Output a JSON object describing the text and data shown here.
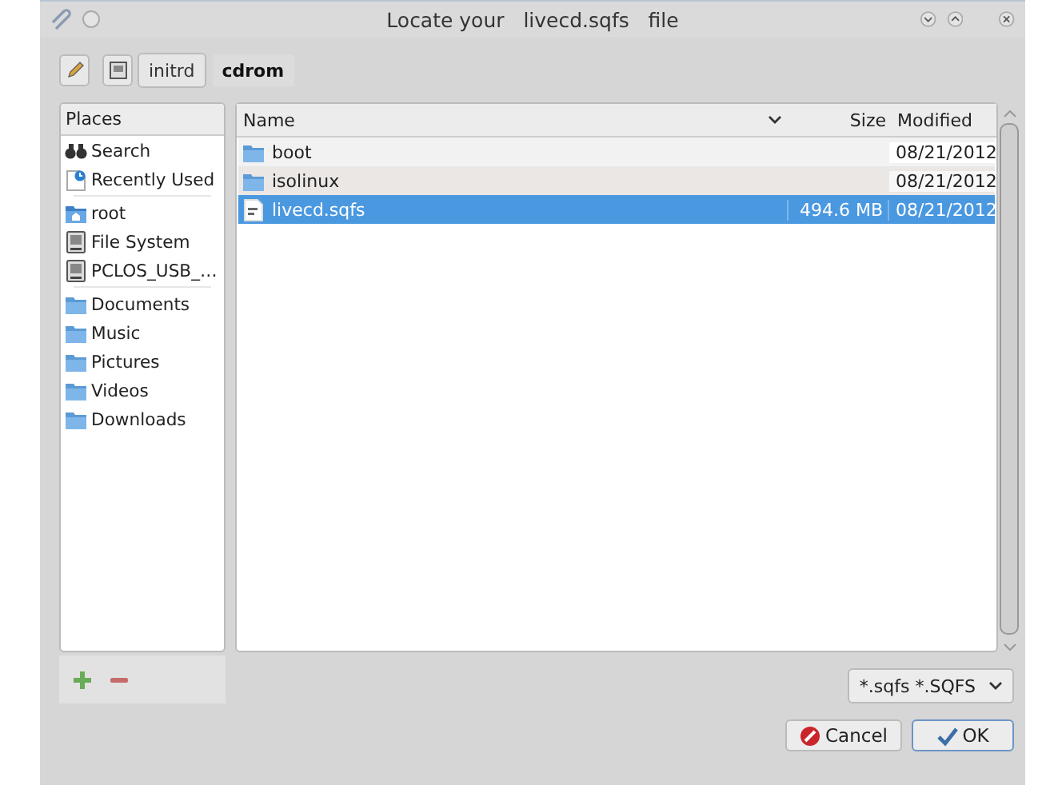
{
  "window": {
    "title": "Locate your   livecd.sqfs   file"
  },
  "breadcrumb": [
    {
      "label": "initrd",
      "selected": false
    },
    {
      "label": "cdrom",
      "selected": true
    }
  ],
  "places": {
    "header": "Places",
    "groups": [
      [
        {
          "label": "Search",
          "kind": "search"
        },
        {
          "label": "Recently Used",
          "kind": "recent"
        }
      ],
      [
        {
          "label": "root",
          "kind": "home"
        },
        {
          "label": "File System",
          "kind": "drive"
        },
        {
          "label": "PCLOS_USB_…",
          "kind": "drive"
        }
      ],
      [
        {
          "label": "Documents",
          "kind": "folder"
        },
        {
          "label": "Music",
          "kind": "folder"
        },
        {
          "label": "Pictures",
          "kind": "folder"
        },
        {
          "label": "Videos",
          "kind": "folder"
        },
        {
          "label": "Downloads",
          "kind": "folder"
        }
      ]
    ]
  },
  "files": {
    "columns": [
      "Name",
      "Size",
      "Modified"
    ],
    "rows": [
      {
        "name": "boot",
        "kind": "folder",
        "size": "",
        "modified": "08/21/2012",
        "selected": false
      },
      {
        "name": "isolinux",
        "kind": "folder",
        "size": "",
        "modified": "08/21/2012",
        "selected": false
      },
      {
        "name": "livecd.sqfs",
        "kind": "file",
        "size": "494.6 MB",
        "modified": "08/21/2012",
        "selected": true
      }
    ]
  },
  "filter": {
    "value": "*.sqfs *.SQFS"
  },
  "buttons": [
    {
      "label": "Cancel",
      "kind": "cancel"
    },
    {
      "label": "OK",
      "kind": "ok"
    }
  ]
}
